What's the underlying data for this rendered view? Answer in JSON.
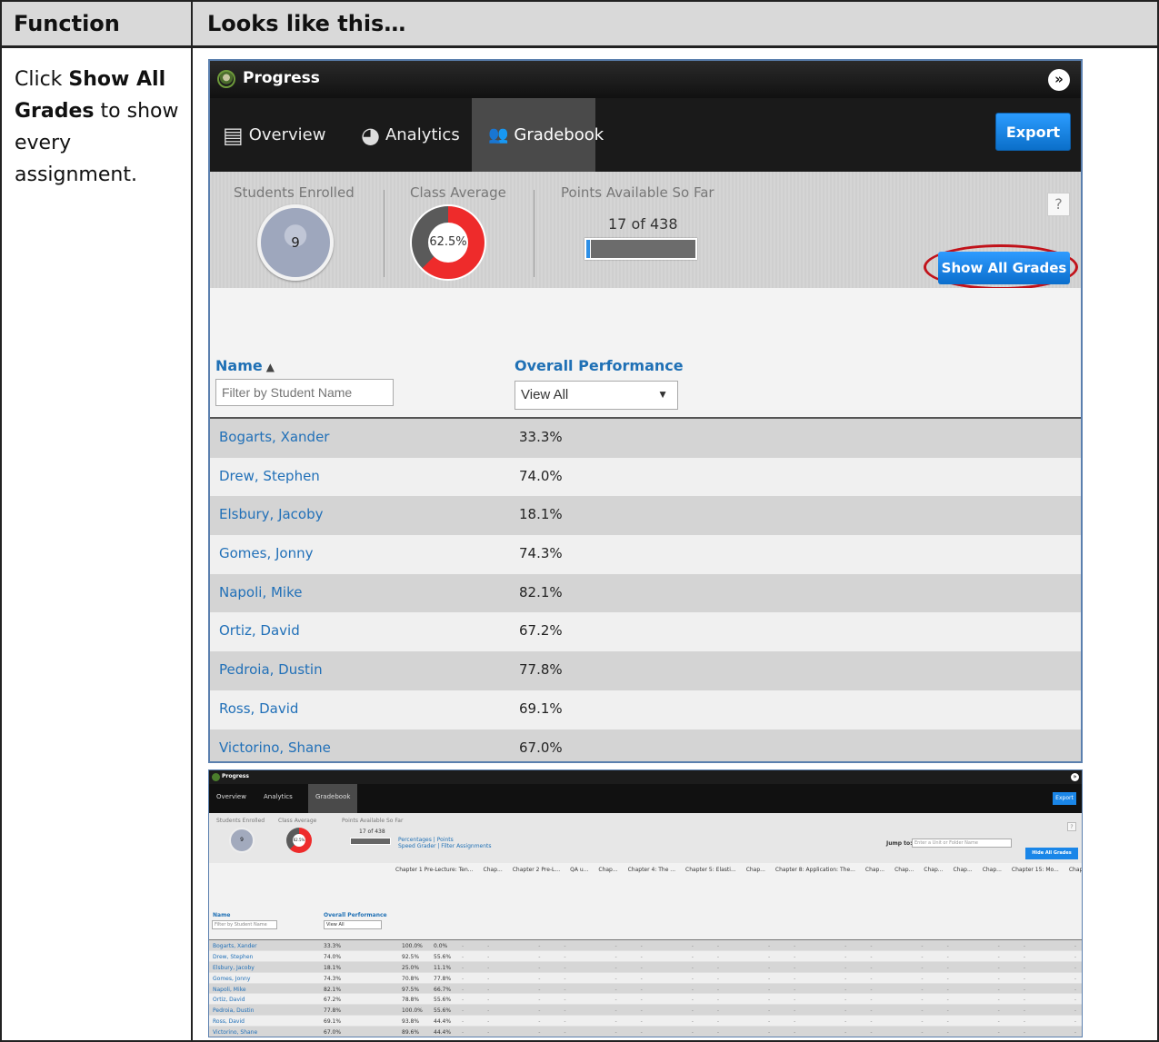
{
  "doc": {
    "col1_header": "Function",
    "col2_header": "Looks like this…",
    "instruction_pre": "Click ",
    "instruction_bold": "Show All Grades",
    "instruction_post": " to show every assignment."
  },
  "app": {
    "title": "Progress",
    "collapse_icon": "»",
    "tabs": [
      {
        "label": "Overview",
        "icon": "document-icon"
      },
      {
        "label": "Analytics",
        "icon": "donut-icon"
      },
      {
        "label": "Gradebook",
        "icon": "people-icon"
      }
    ],
    "export_label": "Export",
    "stats": {
      "students_label": "Students Enrolled",
      "students_count": "9",
      "average_label": "Class Average",
      "average_value": "62.5%",
      "average_fraction": 0.625,
      "points_label": "Points Available So Far",
      "points_value": "17 of 438",
      "points_fraction": 0.0388
    },
    "help_label": "?",
    "show_all_label": "Show All Grades",
    "columns": {
      "name": "Name",
      "sort_icon": "▲",
      "name_filter_placeholder": "Filter by Student Name",
      "performance": "Overall Performance",
      "performance_select": "View All"
    },
    "students": [
      {
        "name": "Bogarts, Xander",
        "score": "33.3%"
      },
      {
        "name": "Drew, Stephen",
        "score": "74.0%"
      },
      {
        "name": "Elsbury, Jacoby",
        "score": "18.1%"
      },
      {
        "name": "Gomes, Jonny",
        "score": "74.3%"
      },
      {
        "name": "Napoli, Mike",
        "score": "82.1%"
      },
      {
        "name": "Ortiz, David",
        "score": "67.2%"
      },
      {
        "name": "Pedroia, Dustin",
        "score": "77.8%"
      },
      {
        "name": "Ross, David",
        "score": "69.1%"
      },
      {
        "name": "Victorino, Shane",
        "score": "67.0%"
      }
    ]
  },
  "mini": {
    "links1": "Percentages | Points",
    "links2": "Speed Grader | Filter Assignments",
    "jump_label": "Jump to:",
    "jump_placeholder": "Enter a Unit or Folder Name",
    "hide_label": "Hide All Grades",
    "chapters": [
      "Chapter 1 Pre-Lecture: Ten...",
      "Chap...",
      "Chapter 2 Pre-L...",
      "QA u...",
      "Chap...",
      "Chapter 4: The ...",
      "Chapter 5: Elasti...",
      "Chap...",
      "Chapter 8: Application: The...",
      "Chap...",
      "Chap...",
      "Chap...",
      "Chap...",
      "Chap...",
      "Chapter 15: Mo...",
      "Chap..."
    ],
    "rows": [
      {
        "c1": "100.0%",
        "c2": "0.0%"
      },
      {
        "c1": "92.5%",
        "c2": "55.6%"
      },
      {
        "c1": "25.0%",
        "c2": "11.1%"
      },
      {
        "c1": "70.8%",
        "c2": "77.8%"
      },
      {
        "c1": "97.5%",
        "c2": "66.7%"
      },
      {
        "c1": "78.8%",
        "c2": "55.6%"
      },
      {
        "c1": "100.0%",
        "c2": "55.6%"
      },
      {
        "c1": "93.8%",
        "c2": "44.4%"
      },
      {
        "c1": "89.6%",
        "c2": "44.4%"
      }
    ],
    "dash_cells": "-- -- -- -- -- -- -- -- -- -- -- -- -- -- -- -- -- -- -- -- --"
  }
}
